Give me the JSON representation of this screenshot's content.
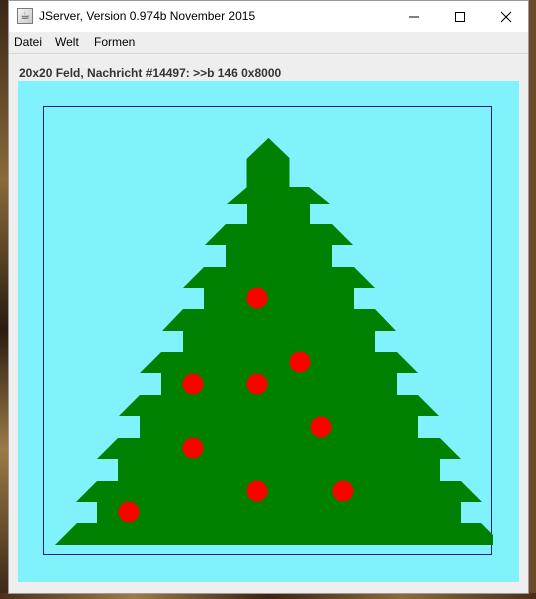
{
  "window": {
    "title": "JServer, Version 0.974b November 2015",
    "icon": "java-app-icon",
    "controls": [
      "minimize-icon",
      "maximize-icon",
      "close-icon"
    ]
  },
  "menu": {
    "items": [
      "Datei",
      "Welt",
      "Formen"
    ]
  },
  "status": {
    "text": "20x20 Feld, Nachricht #14497: >>b 146 0x8000"
  },
  "board": {
    "background_color": "#80f2fc",
    "tree_color": "#008000",
    "ornament_color": "#ff0000",
    "border_color": "#1a1a8c"
  }
}
